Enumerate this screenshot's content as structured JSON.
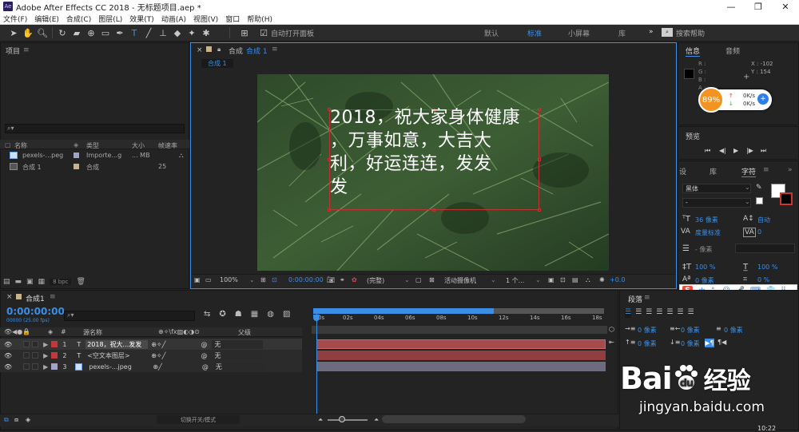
{
  "window": {
    "title": "Adobe After Effects CC 2018 - 无标题项目.aep *",
    "app_badge": "Ae",
    "min": "—",
    "restore": "❐",
    "close": "✕"
  },
  "menu": [
    "文件(F)",
    "编辑(E)",
    "合成(C)",
    "图层(L)",
    "效果(T)",
    "动画(A)",
    "视图(V)",
    "窗口",
    "帮助(H)"
  ],
  "toolbar": {
    "auto_open_label": "自动打开面板",
    "workspaces": [
      "默认",
      "标准",
      "小屏幕",
      "库"
    ],
    "active_workspace": "标准",
    "more": "»",
    "search_placeholder": "搜索帮助"
  },
  "project_panel": {
    "title": "项目",
    "search_icon": "⌕▾",
    "columns": [
      "名称",
      "类型",
      "大小",
      "帧速率"
    ],
    "items": [
      {
        "name": "pexels-...peg",
        "type": "Importe...g",
        "size": "... MB",
        "fps": ""
      },
      {
        "name": "合成 1",
        "type": "合成",
        "size": "",
        "fps": "25"
      }
    ],
    "bpc": "8 bpc"
  },
  "comp_panel": {
    "title": "合成",
    "comp_name": "合成 1",
    "tab": "合成 1",
    "overlay_text": [
      "2018，祝大家身体健康",
      "，万事如意，大吉大",
      "利，好运连连，发发",
      "发"
    ],
    "zoom": "100%",
    "timecode": "0:00:00:00",
    "quality": "(完整)",
    "camera": "活动摄像机",
    "views": "1 个...",
    "exposure": "+0.0"
  },
  "info_panel": {
    "tab_info": "信息",
    "tab_audio": "音频",
    "r": "R :",
    "g": "G :",
    "b": "B :",
    "a": "A :",
    "x": "X : -102",
    "y": "Y : 154",
    "plus": "+"
  },
  "net_widget": {
    "percent": "89%",
    "up": "0K/s",
    "down": "0K/s"
  },
  "preview_panel": {
    "title": "预览",
    "controls": [
      "⏮",
      "◀|",
      "▶",
      "|▶",
      "⏭"
    ]
  },
  "char_panel": {
    "tab_left": "设",
    "tab_lib": "库",
    "tab_char": "字符",
    "font": "黑体",
    "style": "-",
    "size": "36 像素",
    "leading": "自动",
    "kerning": "度量标准",
    "tracking": "0",
    "stroke": "- 像素",
    "vscale": "100 %",
    "hscale": "100 %",
    "baseline": "0 像素",
    "tsume": "0 %"
  },
  "para_panel": {
    "title": "段落",
    "indent_left": "0 像素",
    "indent_right": "0 像素",
    "indent_first": "0 像素",
    "space_before": "0 像素",
    "space_after": "0 像素"
  },
  "timeline": {
    "tab": "合成1",
    "timecode": "0:00:00:00",
    "sub_timecode": "00000 (25.00 fps)",
    "header_source": "源名称",
    "header_parent": "父级",
    "ruler": [
      "0s",
      "02s",
      "04s",
      "06s",
      "08s",
      "10s",
      "12s",
      "14s",
      "16s",
      "18s"
    ],
    "layers": [
      {
        "num": "1",
        "type": "T",
        "name": "2018，祝大...发发",
        "parent": "无",
        "color": "#c0393b"
      },
      {
        "num": "2",
        "type": "T",
        "name": "<空文本图层>",
        "parent": "无",
        "color": "#c0393b"
      },
      {
        "num": "3",
        "type": "img",
        "name": "pexels-...jpeg",
        "parent": "无",
        "color": "#a3a3c8"
      }
    ],
    "toggle_label": "切换开关/模式"
  },
  "ime": {
    "brand": "S",
    "lang": "中",
    "items": [
      "°,",
      "☺",
      "🎤",
      "⌨",
      "👕",
      "⠿"
    ]
  },
  "watermark": {
    "brand": "Bai",
    "brand2": "经验",
    "url": "jingyan.baidu.com",
    "clock": "10:22"
  },
  "colors": {
    "accent": "#3a8ee6",
    "layer_red": "#c0393b",
    "layer_gray": "#a3a3c8",
    "bar_red": "#a54b4b",
    "bar_gray": "#6c6c7e"
  }
}
